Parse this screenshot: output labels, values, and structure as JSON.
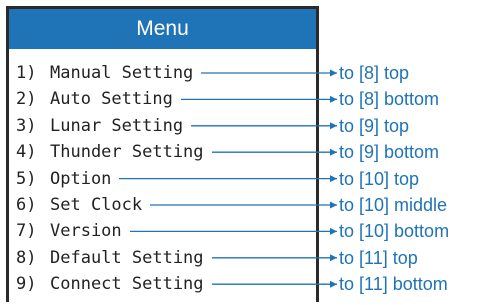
{
  "menu": {
    "title": "Menu",
    "items": [
      {
        "number": "1)",
        "label": "Manual Setting",
        "target": "to [8] top"
      },
      {
        "number": "2)",
        "label": "Auto Setting",
        "target": "to [8] bottom"
      },
      {
        "number": "3)",
        "label": "Lunar Setting",
        "target": "to [9] top"
      },
      {
        "number": "4)",
        "label": "Thunder Setting",
        "target": "to [9] bottom"
      },
      {
        "number": "5)",
        "label": "Option",
        "target": "to [10] top"
      },
      {
        "number": "6)",
        "label": "Set Clock",
        "target": "to [10] middle"
      },
      {
        "number": "7)",
        "label": "Version",
        "target": "to [10] bottom"
      },
      {
        "number": "8)",
        "label": "Default Setting",
        "target": "to [11] top"
      },
      {
        "number": "9)",
        "label": "Connect Setting",
        "target": "to [11] bottom"
      }
    ]
  },
  "colors": {
    "accent": "#1f73b7",
    "border": "#2a2a2a",
    "text": "#222222"
  }
}
